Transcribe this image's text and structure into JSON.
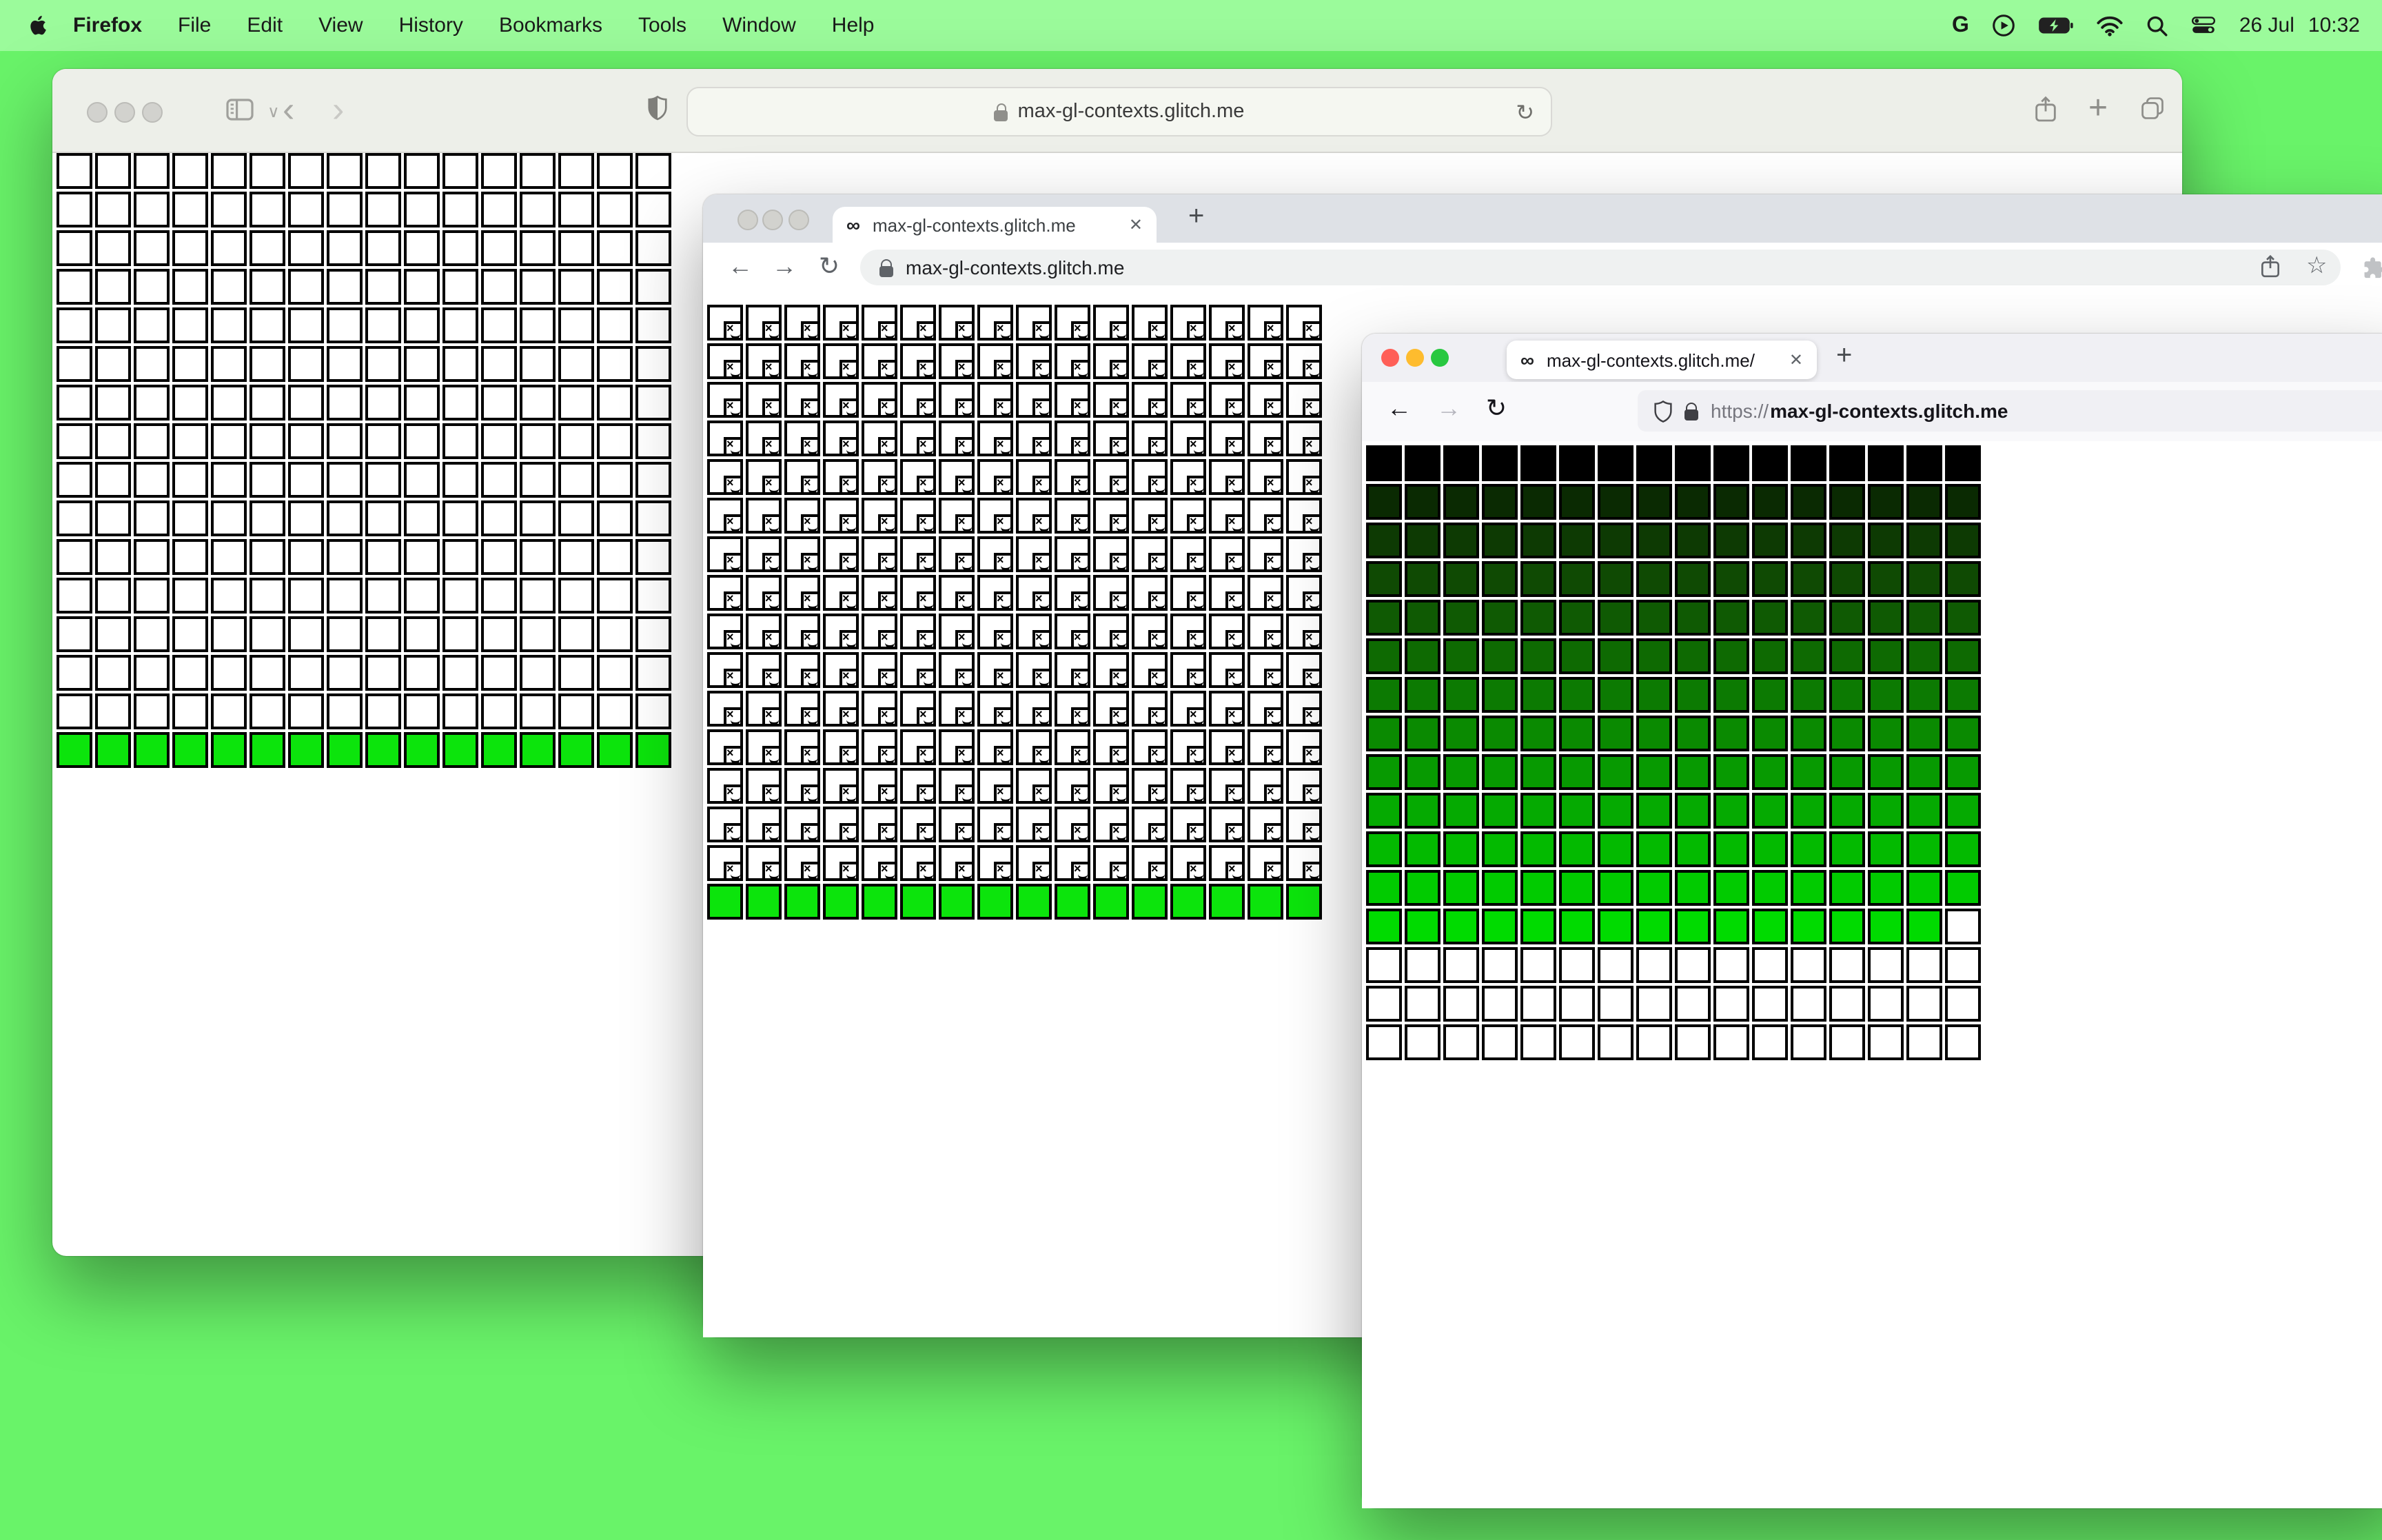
{
  "menu_bar": {
    "menus": [
      "Firefox",
      "File",
      "Edit",
      "View",
      "History",
      "Bookmarks",
      "Tools",
      "Window",
      "Help"
    ],
    "status_icons": [
      "google-icon",
      "play-circle-icon",
      "battery-charging-icon",
      "wifi-icon",
      "search-icon",
      "control-center-icon"
    ],
    "google_glyph": "G",
    "date": "26 Jul",
    "time": "10:32"
  },
  "colors": {
    "desktop": "#69f369",
    "menubar": "#9bfb9b",
    "safari_toolbar": "#edefe9",
    "chrome_tabbar": "#dee1e6",
    "firefox_tabbar": "#f0f0f4",
    "active_green": "#0ce40c",
    "firefox_bright_green": "#00db00"
  },
  "safari": {
    "url": "max-gl-contexts.glitch.me",
    "icons": {
      "back": "‹",
      "forward": "›",
      "refresh": "↻",
      "new_tab": "+",
      "sidebar_chevron": "∨"
    },
    "grid": {
      "cols": 16,
      "rows": [
        {
          "repeat": 15,
          "type": "empty"
        },
        {
          "repeat": 1,
          "type": "fill",
          "color": "#0ce40c"
        }
      ]
    }
  },
  "chrome": {
    "tab_title": "max-gl-contexts.glitch.me",
    "url": "max-gl-contexts.glitch.me",
    "favicon_glyph": "∞",
    "close_glyph": "✕",
    "new_tab_glyph": "+",
    "icons": {
      "back": "←",
      "forward": "→",
      "refresh": "↻",
      "star": "☆"
    },
    "grid": {
      "cols": 16,
      "rows": [
        {
          "repeat": 15,
          "type": "broken"
        },
        {
          "repeat": 1,
          "type": "fill",
          "color": "#0ce40c"
        }
      ]
    }
  },
  "firefox": {
    "tab_title": "max-gl-contexts.glitch.me/",
    "url_scheme": "https://",
    "url_host": "max-gl-contexts.glitch.me",
    "favicon_glyph": "∞",
    "close_glyph": "✕",
    "new_tab_glyph": "+",
    "icons": {
      "back": "←",
      "forward": "→",
      "refresh": "↻"
    },
    "grid": {
      "cols": 16,
      "rows": [
        {
          "type": "fill",
          "color": "#000000"
        },
        {
          "type": "fill",
          "color": "#0a2a02"
        },
        {
          "type": "fill",
          "color": "#0d3a03"
        },
        {
          "type": "fill",
          "color": "#0f4a03"
        },
        {
          "type": "fill",
          "color": "#0f5a03"
        },
        {
          "type": "fill",
          "color": "#0e6a02"
        },
        {
          "type": "fill",
          "color": "#0c7a02"
        },
        {
          "type": "fill",
          "color": "#0a8a01"
        },
        {
          "type": "fill",
          "color": "#079a01"
        },
        {
          "type": "fill",
          "color": "#05aa01"
        },
        {
          "type": "fill",
          "color": "#03ba00"
        },
        {
          "type": "fill",
          "color": "#01cb00"
        },
        {
          "type": "fill",
          "color": "#00db00",
          "empty_last": true
        },
        {
          "repeat": 3,
          "type": "empty"
        }
      ]
    }
  }
}
